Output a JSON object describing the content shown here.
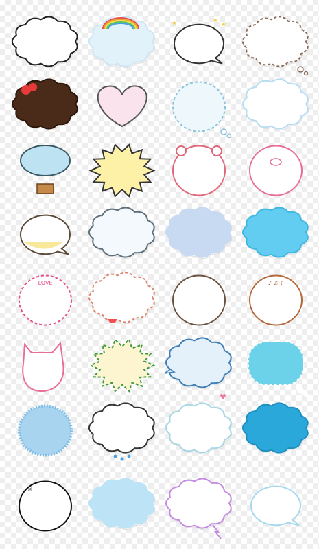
{
  "sticker_sheet": {
    "columns": 4,
    "rows": 8,
    "stickers": [
      {
        "id": "r1c1",
        "shape": "cloud",
        "fill": "#ffffff",
        "stroke": "#222222",
        "dash": false,
        "deco": "wings"
      },
      {
        "id": "r1c2",
        "shape": "cloud",
        "fill": "#e2f2fb",
        "stroke": "#cfe6f3",
        "dash": false,
        "deco": "rainbow"
      },
      {
        "id": "r1c3",
        "shape": "speech",
        "fill": "#ffffff",
        "stroke": "#333333",
        "dash": false,
        "deco": "stars"
      },
      {
        "id": "r1c4",
        "shape": "cloud",
        "fill": "#ffffff",
        "stroke": "#8b6a5a",
        "dash": true,
        "deco": "thought"
      },
      {
        "id": "r2c1",
        "shape": "cloud",
        "fill": "#4a2a18",
        "stroke": "#2b160a",
        "dash": false,
        "deco": "strawberries"
      },
      {
        "id": "r2c2",
        "shape": "heart",
        "fill": "#fbe3ee",
        "stroke": "#555555",
        "dash": false,
        "deco": "tail"
      },
      {
        "id": "r2c3",
        "shape": "circle",
        "fill": "#eef8fc",
        "stroke": "#88c4dd",
        "dash": true,
        "deco": "thought"
      },
      {
        "id": "r2c4",
        "shape": "cloud",
        "fill": "#ffffff",
        "stroke": "#b6ddf1",
        "dash": false,
        "deco": "none"
      },
      {
        "id": "r3c1",
        "shape": "balloon",
        "fill": "#bde3f2",
        "stroke": "#3c5a66",
        "dash": false,
        "deco": "basket"
      },
      {
        "id": "r3c2",
        "shape": "burst",
        "fill": "#fdf1a8",
        "stroke": "#333333",
        "dash": false,
        "deco": "none"
      },
      {
        "id": "r3c3",
        "shape": "circle",
        "fill": "#ffffff",
        "stroke": "#e06679",
        "dash": false,
        "deco": "bear"
      },
      {
        "id": "r3c4",
        "shape": "circle",
        "fill": "#ffffff",
        "stroke": "#e86d97",
        "dash": false,
        "deco": "pig"
      },
      {
        "id": "r4c1",
        "shape": "speech",
        "fill": "#ffffff",
        "stroke": "#5b4a3a",
        "dash": false,
        "deco": "yellow-base"
      },
      {
        "id": "r4c2",
        "shape": "cloud",
        "fill": "#f3f9fc",
        "stroke": "#5e6e78",
        "dash": false,
        "deco": "bubbles"
      },
      {
        "id": "r4c3",
        "shape": "cloud",
        "fill": "#c7daf2",
        "stroke": "#c7daf2",
        "dash": false,
        "deco": "checker"
      },
      {
        "id": "r4c4",
        "shape": "cloud",
        "fill": "#62cdf0",
        "stroke": "#3fb7e0",
        "dash": false,
        "deco": "glossy"
      },
      {
        "id": "r5c1",
        "shape": "circle",
        "fill": "#ffffff",
        "stroke": "#e34f8c",
        "dash": true,
        "deco": "love"
      },
      {
        "id": "r5c2",
        "shape": "cloud",
        "fill": "#ffffff",
        "stroke": "#e0826a",
        "dash": true,
        "deco": "watermelon"
      },
      {
        "id": "r5c3",
        "shape": "circle",
        "fill": "#ffffff",
        "stroke": "#6b5240",
        "dash": false,
        "deco": "vine"
      },
      {
        "id": "r5c4",
        "shape": "circle",
        "fill": "#ffffff",
        "stroke": "#b3683a",
        "dash": false,
        "deco": "music"
      },
      {
        "id": "r6c1",
        "shape": "cat",
        "fill": "#ffffff",
        "stroke": "#e86d97",
        "dash": false,
        "deco": "cat"
      },
      {
        "id": "r6c2",
        "shape": "burst",
        "fill": "#fdf5cf",
        "stroke": "#3f9a3a",
        "dash": true,
        "deco": "sprout"
      },
      {
        "id": "r6c3",
        "shape": "cloud",
        "fill": "#e4f0fa",
        "stroke": "#3e7fb8",
        "dash": false,
        "deco": "tail-left"
      },
      {
        "id": "r6c4",
        "shape": "rounded",
        "fill": "#6cd2ea",
        "stroke": "#ffffff",
        "dash": true,
        "deco": "thought"
      },
      {
        "id": "r7c1",
        "shape": "scribble",
        "fill": "#a8d4f0",
        "stroke": "#7ebde6",
        "dash": false,
        "deco": "none"
      },
      {
        "id": "r7c2",
        "shape": "cloud",
        "fill": "#ffffff",
        "stroke": "#333333",
        "dash": false,
        "deco": "rain"
      },
      {
        "id": "r7c3",
        "shape": "cloud",
        "fill": "#ffffff",
        "stroke": "#a8d8e4",
        "dash": false,
        "deco": "swirls"
      },
      {
        "id": "r7c4",
        "shape": "cloud",
        "fill": "#29a8d9",
        "stroke": "#1d8fc0",
        "dash": false,
        "deco": "puff"
      },
      {
        "id": "r8c1",
        "shape": "circle",
        "fill": "#ffffff",
        "stroke": "#111111",
        "dash": false,
        "deco": "skull"
      },
      {
        "id": "r8c2",
        "shape": "cloud",
        "fill": "#bde3f7",
        "stroke": "#bde3f7",
        "dash": false,
        "deco": "none"
      },
      {
        "id": "r8c3",
        "shape": "cloud",
        "fill": "#ffffff",
        "stroke": "#c48be0",
        "dash": false,
        "deco": "lightning"
      },
      {
        "id": "r8c4",
        "shape": "speech",
        "fill": "#ffffff",
        "stroke": "#a6d8ee",
        "dash": false,
        "deco": "none"
      }
    ]
  },
  "texts": {
    "love_label": "LOVE"
  },
  "colors": {
    "heart_small": "#f27aa0"
  }
}
